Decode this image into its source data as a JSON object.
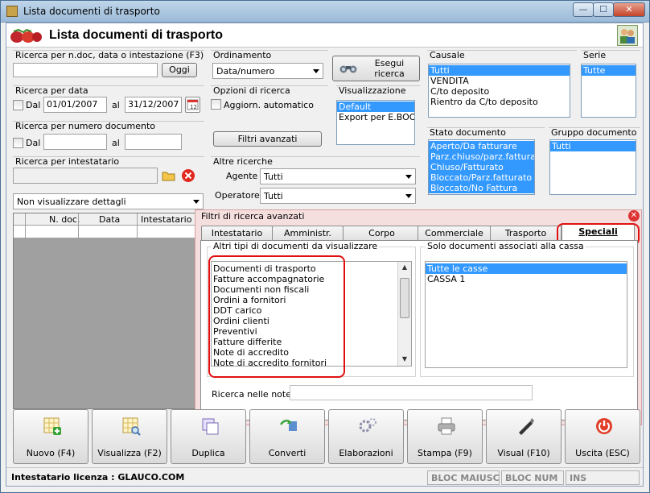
{
  "window": {
    "title": "Lista documenti di trasporto",
    "min": "—",
    "max": "☐",
    "close": "✕"
  },
  "header": {
    "title": "Lista documenti di trasporto"
  },
  "search_text": {
    "label": "Ricerca per n.doc, data o intestazione (F3)",
    "value": "",
    "button": "Oggi"
  },
  "search_date": {
    "label": "Ricerca per data",
    "dal": "Dal",
    "from": "01/01/2007",
    "al": "al",
    "to": "31/12/2007"
  },
  "search_number": {
    "label": "Ricerca per numero documento",
    "dal": "Dal",
    "from": "",
    "al": "al",
    "to": ""
  },
  "search_holder": {
    "label": "Ricerca per intestatario",
    "value": ""
  },
  "details_combo": {
    "value": "Non visualizzare dettagli"
  },
  "ordering": {
    "label": "Ordinamento",
    "value": "Data/numero"
  },
  "run_search": {
    "label_line1": "Esegui",
    "label_line2": "ricerca"
  },
  "search_options": {
    "label": "Opzioni di ricerca",
    "auto_update": "Aggiorn. automatico",
    "advanced_filters": "Filtri avanzati"
  },
  "display": {
    "label": "Visualizzazione",
    "items": [
      "Default",
      "Export per E.BOOST"
    ],
    "selected": 0
  },
  "other_searches": {
    "label": "Altre ricerche",
    "agent_label": "Agente :",
    "agent_value": "Tutti",
    "operator_label": "Operatore :",
    "operator_value": "Tutti"
  },
  "causale": {
    "label": "Causale",
    "items": [
      "Tutti",
      "VENDITA",
      "C/to deposito",
      "Rientro da C/to deposito"
    ],
    "selected": [
      0
    ]
  },
  "serie": {
    "label": "Serie",
    "items": [
      "Tutte"
    ],
    "selected": [
      0
    ]
  },
  "doc_state": {
    "label": "Stato documento",
    "items": [
      "Aperto/Da fatturare",
      "Parz.chiuso/parz.fatturato",
      "Chiuso/Fatturato",
      "Bloccato/Parz.fatturato",
      "Bloccato/No Fattura"
    ],
    "selected": [
      0,
      1,
      2,
      3,
      4
    ]
  },
  "doc_group": {
    "label": "Gruppo documento",
    "items": [
      "Tutti"
    ],
    "selected": [
      0
    ]
  },
  "grid": {
    "columns": [
      "N. doc.",
      "Data",
      "Intestatario"
    ]
  },
  "advanced_panel": {
    "title": "Filtri di ricerca avanzati",
    "tabs": [
      "Intestatario",
      "Amministr.",
      "Corpo",
      "Commerciale",
      "Trasporto",
      "Speciali"
    ],
    "active_tab": 5,
    "doc_types": {
      "label": "Altri tipi di documenti da visualizzare",
      "items": [
        "Documenti di trasporto",
        "Fatture accompagnatorie",
        "Documenti non fiscali",
        "Ordini a fornitori",
        "DDT carico",
        "Ordini clienti",
        "Preventivi",
        "Fatture differite",
        "Note di accredito",
        "Note di accredito fornitori"
      ]
    },
    "cash": {
      "label": "Solo documenti associati alla cassa",
      "items": [
        "Tutte le casse",
        "CASSA 1"
      ],
      "selected": 0
    },
    "notes": {
      "label": "Ricerca nelle note",
      "value": ""
    }
  },
  "toolbar": {
    "buttons": [
      "Nuovo (F4)",
      "Visualizza (F2)",
      "Duplica",
      "Converti",
      "Elaborazioni",
      "Stampa (F9)",
      "Visual (F10)",
      "Uscita (ESC)"
    ]
  },
  "status": {
    "license_label": "Intestatario licenza :",
    "license_value": "GLAUCO.COM",
    "caps": "BLOC MAIUSC",
    "num": "BLOC NUM",
    "ins": "INS"
  },
  "colors": {
    "selection": "#3399ff",
    "highlight": "#e01010",
    "panel": "#f4dede"
  }
}
